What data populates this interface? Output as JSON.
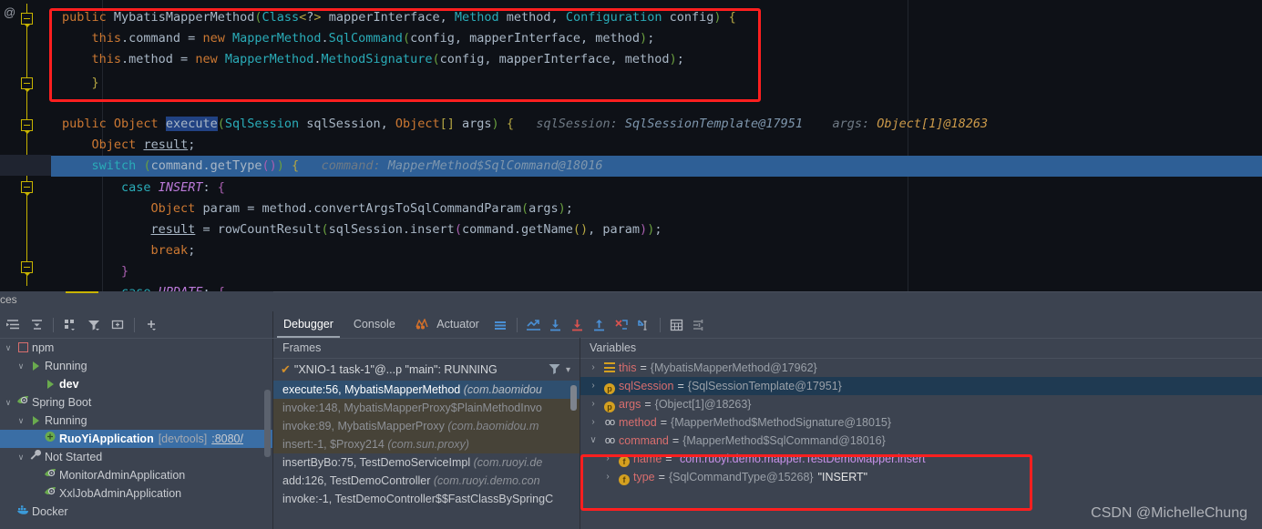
{
  "editor": {
    "gutter_symbol": "@",
    "lines": [
      {
        "id": "l1",
        "text": "public MybatisMapperMethod(Class<?> mapperInterface, Method method, Configuration config) {"
      },
      {
        "id": "l2",
        "text": "    this.command = new MapperMethod.SqlCommand(config, mapperInterface, method);"
      },
      {
        "id": "l3",
        "text": "    this.method = new MapperMethod.MethodSignature(config, mapperInterface, method);"
      },
      {
        "id": "l4",
        "text": "}"
      },
      {
        "id": "l5",
        "text": "public Object execute(SqlSession sqlSession, Object[] args) {"
      },
      {
        "id": "l6",
        "text": "    Object result;"
      },
      {
        "id": "l7",
        "text": "    switch (command.getType()) {"
      },
      {
        "id": "l8",
        "text": "        case INSERT: {"
      },
      {
        "id": "l9",
        "text": "            Object param = method.convertArgsToSqlCommandParam(args);"
      },
      {
        "id": "l10",
        "text": "            result = rowCountResult(sqlSession.insert(command.getName(), param));"
      },
      {
        "id": "l11",
        "text": "            break;"
      },
      {
        "id": "l12",
        "text": "        }"
      },
      {
        "id": "l13",
        "text": "        case UPDATE: {"
      }
    ],
    "inline_hints": {
      "sql_session_label": "sqlSession:",
      "sql_session_value": "SqlSessionTemplate@17951",
      "args_label": "args:",
      "args_value": "Object[1]@18263",
      "command_label": "command:",
      "command_value": "MapperMethod$SqlCommand@18016"
    }
  },
  "services": {
    "tab_label": "ces",
    "toolbar": [
      {
        "name": "expand-all-icon",
        "glyph": "≡"
      },
      {
        "name": "collapse-all-icon",
        "glyph": "⤓"
      },
      {
        "name": "group-by-icon",
        "glyph": "∷"
      },
      {
        "name": "filter-icon",
        "glyph": "▼"
      },
      {
        "name": "add-tab-icon",
        "glyph": "⊕"
      },
      {
        "name": "add-service-icon",
        "glyph": "+"
      }
    ],
    "tree": [
      {
        "depth": 0,
        "twisty": "∨",
        "icon": "npm-icon",
        "label": "npm",
        "kind": "normal"
      },
      {
        "depth": 1,
        "twisty": "∨",
        "icon": "run-icon",
        "label": "Running",
        "kind": "normal"
      },
      {
        "depth": 2,
        "twisty": "",
        "icon": "run-icon",
        "label": "dev",
        "kind": "bold"
      },
      {
        "depth": 0,
        "twisty": "∨",
        "icon": "spring-icon",
        "label": "Spring Boot",
        "kind": "normal"
      },
      {
        "depth": 1,
        "twisty": "∨",
        "icon": "run-icon",
        "label": "Running",
        "kind": "normal"
      },
      {
        "depth": 2,
        "twisty": "",
        "icon": "spring-app-icon",
        "label": "RuoYiApplication",
        "kind": "selected",
        "suffix": "[devtools]",
        "link": ":8080/"
      },
      {
        "depth": 1,
        "twisty": "∨",
        "icon": "wrench-icon",
        "label": "Not Started",
        "kind": "normal"
      },
      {
        "depth": 2,
        "twisty": "",
        "icon": "spring-icon",
        "label": "MonitorAdminApplication",
        "kind": "normal"
      },
      {
        "depth": 2,
        "twisty": "",
        "icon": "spring-icon",
        "label": "XxlJobAdminApplication",
        "kind": "normal"
      },
      {
        "depth": 0,
        "twisty": "",
        "icon": "docker-icon",
        "label": "Docker",
        "kind": "normal"
      }
    ]
  },
  "debugger": {
    "tabs": [
      {
        "label": "Debugger",
        "active": true,
        "icon": ""
      },
      {
        "label": "Console",
        "active": false,
        "icon": ""
      },
      {
        "label": "Actuator",
        "active": false,
        "icon": "actuator-icon"
      }
    ],
    "toolbar_icons": [
      {
        "name": "layout-settings-icon",
        "glyph": "☰"
      },
      {
        "name": "show-execution-point-icon",
        "glyph": "↗"
      },
      {
        "name": "step-over-icon",
        "glyph": "↓"
      },
      {
        "name": "step-into-icon",
        "glyph": "↓"
      },
      {
        "name": "step-out-icon",
        "glyph": "↑"
      },
      {
        "name": "force-step-into-icon",
        "glyph": "⤡"
      },
      {
        "name": "run-to-cursor-icon",
        "glyph": "↘"
      },
      {
        "name": "evaluate-expression-icon",
        "glyph": "▦"
      },
      {
        "name": "settings-icon",
        "glyph": "☲"
      }
    ],
    "frames": {
      "header": "Frames",
      "thread": "\"XNIO-1 task-1\"@...p \"main\": RUNNING",
      "rows": [
        {
          "text": "execute:56, MybatisMapperMethod ",
          "pkg": "(com.baomidou",
          "state": "current"
        },
        {
          "text": "invoke:148, MybatisMapperProxy$PlainMethodInvo",
          "pkg": "",
          "state": "library"
        },
        {
          "text": "invoke:89, MybatisMapperProxy ",
          "pkg": "(com.baomidou.m",
          "state": "library"
        },
        {
          "text": "insert:-1, $Proxy214 ",
          "pkg": "(com.sun.proxy)",
          "state": "library"
        },
        {
          "text": "insertByBo:75, TestDemoServiceImpl ",
          "pkg": "(com.ruoyi.de",
          "state": "normal"
        },
        {
          "text": "add:126, TestDemoController ",
          "pkg": "(com.ruoyi.demo.con",
          "state": "normal"
        },
        {
          "text": "invoke:-1, TestDemoController$$FastClassBySpringC",
          "pkg": "",
          "state": "normal"
        }
      ]
    },
    "variables": {
      "header": "Variables",
      "rows": [
        {
          "indent": 0,
          "twisty": "›",
          "icon": "field-group-icon",
          "name": "this",
          "value": "{MybatisMapperMethod@17962}",
          "value_type": "ref",
          "selected": false
        },
        {
          "indent": 0,
          "twisty": "›",
          "icon": "parameter-icon",
          "name": "sqlSession",
          "value": "{SqlSessionTemplate@17951}",
          "value_type": "ref",
          "selected": true
        },
        {
          "indent": 0,
          "twisty": "›",
          "icon": "parameter-icon",
          "name": "args",
          "value": "{Object[1]@18263}",
          "value_type": "ref",
          "selected": false
        },
        {
          "indent": 0,
          "twisty": "›",
          "icon": "field-icon",
          "name": "method",
          "value": "{MapperMethod$MethodSignature@18015}",
          "value_type": "ref",
          "selected": false
        },
        {
          "indent": 0,
          "twisty": "∨",
          "icon": "field-icon",
          "name": "command",
          "value": "{MapperMethod$SqlCommand@18016}",
          "value_type": "ref",
          "selected": false
        },
        {
          "indent": 1,
          "twisty": "›",
          "icon": "final-field-icon",
          "name": "name",
          "value": "\"com.ruoyi.demo.mapper.TestDemoMapper.insert\"",
          "value_type": "string",
          "selected": false
        },
        {
          "indent": 1,
          "twisty": "›",
          "icon": "final-field-icon",
          "name": "type",
          "value": "{SqlCommandType@15268}",
          "value_type": "ref-str",
          "value2": "\"INSERT\"",
          "selected": false
        }
      ]
    }
  },
  "watermark": "CSDN @MichelleChung",
  "colors": {
    "editor_bg": "#0e1117",
    "panel_bg": "#3c4350",
    "annotation_red": "#ff1f1f",
    "selection_blue": "#2e5f96",
    "tree_selection": "#3a6ea5",
    "keyword_orange": "#cc7832",
    "string_green": "#6a8759",
    "var_name_red": "#d86e6e"
  }
}
